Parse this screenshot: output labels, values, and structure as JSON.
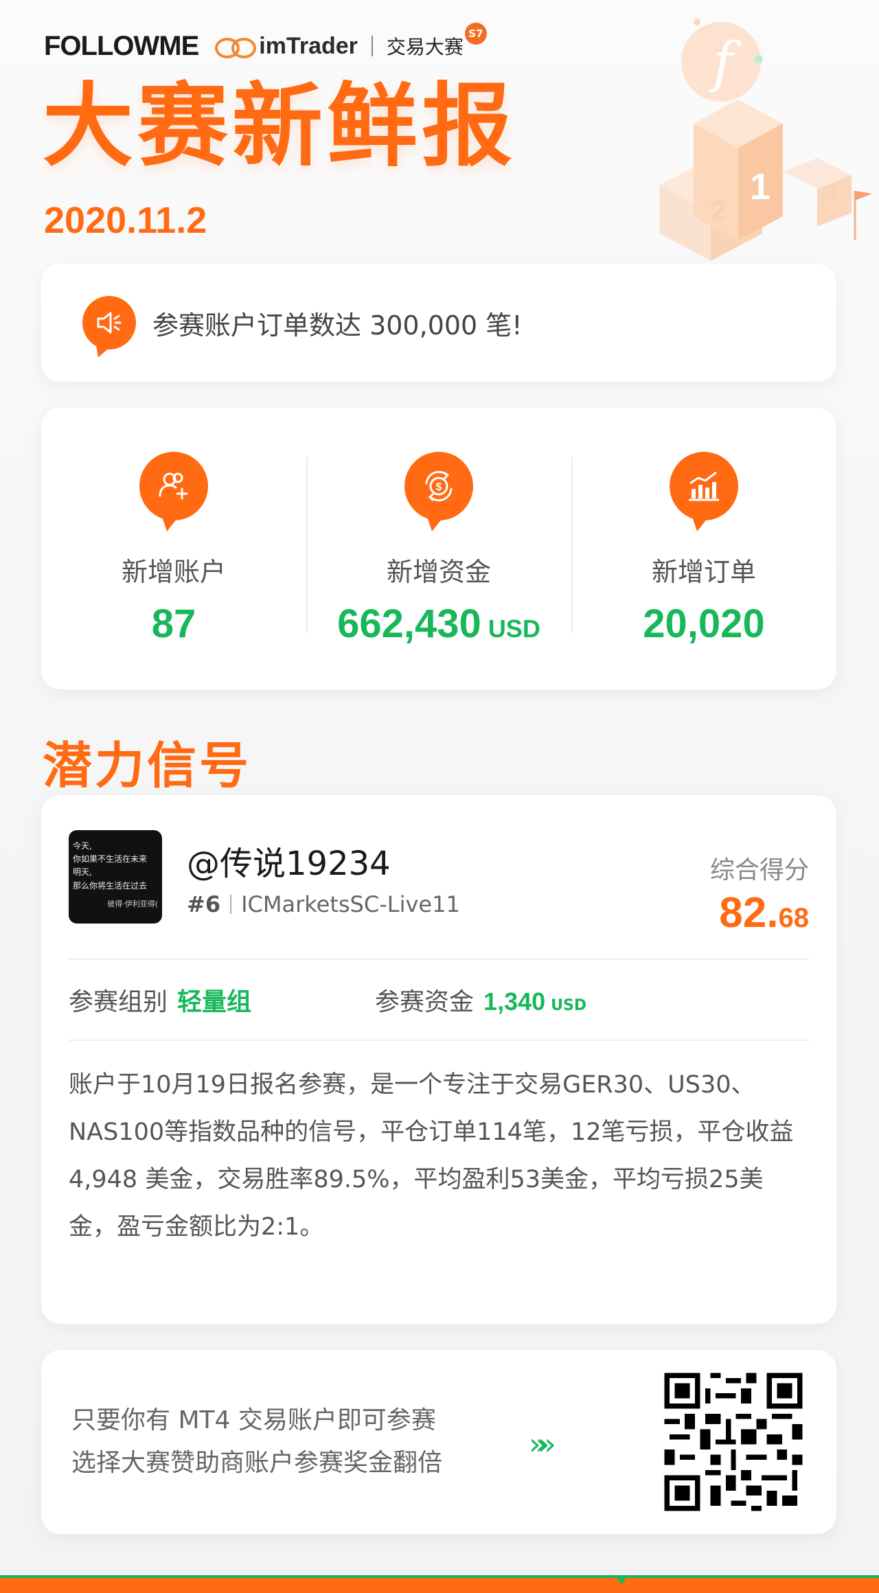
{
  "header": {
    "brand": "FOLLOWME",
    "partner": "imTrader",
    "contest": "交易大赛",
    "season": "S7",
    "title": "大赛新鲜报",
    "date": "2020.11.2"
  },
  "announcement": {
    "icon": "speaker-icon",
    "text": "参赛账户订单数达 300,000 笔!"
  },
  "stats": [
    {
      "icon": "add-user-icon",
      "label": "新增账户",
      "value": "87",
      "unit": ""
    },
    {
      "icon": "money-cycle-icon",
      "label": "新增资金",
      "value": "662,430",
      "unit": "USD"
    },
    {
      "icon": "bar-chart-icon",
      "label": "新增订单",
      "value": "20,020",
      "unit": ""
    }
  ],
  "section": {
    "title": "潜力信号"
  },
  "signal": {
    "avatar_lines": [
      "今天,",
      "你如果不生活在未来",
      "明天,",
      "那么你将生活在过去"
    ],
    "avatar_sign": "彼得·伊利亚得(",
    "name": "@传说19234",
    "rank": "#6",
    "server": "ICMarketsSC-Live11",
    "score_label": "综合得分",
    "score_main": "82.",
    "score_decimal": "68",
    "group_label": "参赛组别",
    "group_value": "轻量组",
    "capital_label": "参赛资金",
    "capital_value": "1,340",
    "capital_unit": "USD",
    "description": "账户于10月19日报名参赛，是一个专注于交易GER30、US30、NAS100等指数品种的信号，平仓订单114笔，12笔亏损，平仓收益 4,948 美金，交易胜率89.5%，平均盈利53美金，平均亏损25美金，盈亏金额比为2:1。"
  },
  "cta": {
    "line1": "只要你有 MT4 交易账户即可参赛",
    "line2": "选择大赛赞助商账户参赛奖金翻倍",
    "arrow": "»»"
  },
  "colors": {
    "accent": "#ff6a13",
    "positive": "#17b85a"
  }
}
